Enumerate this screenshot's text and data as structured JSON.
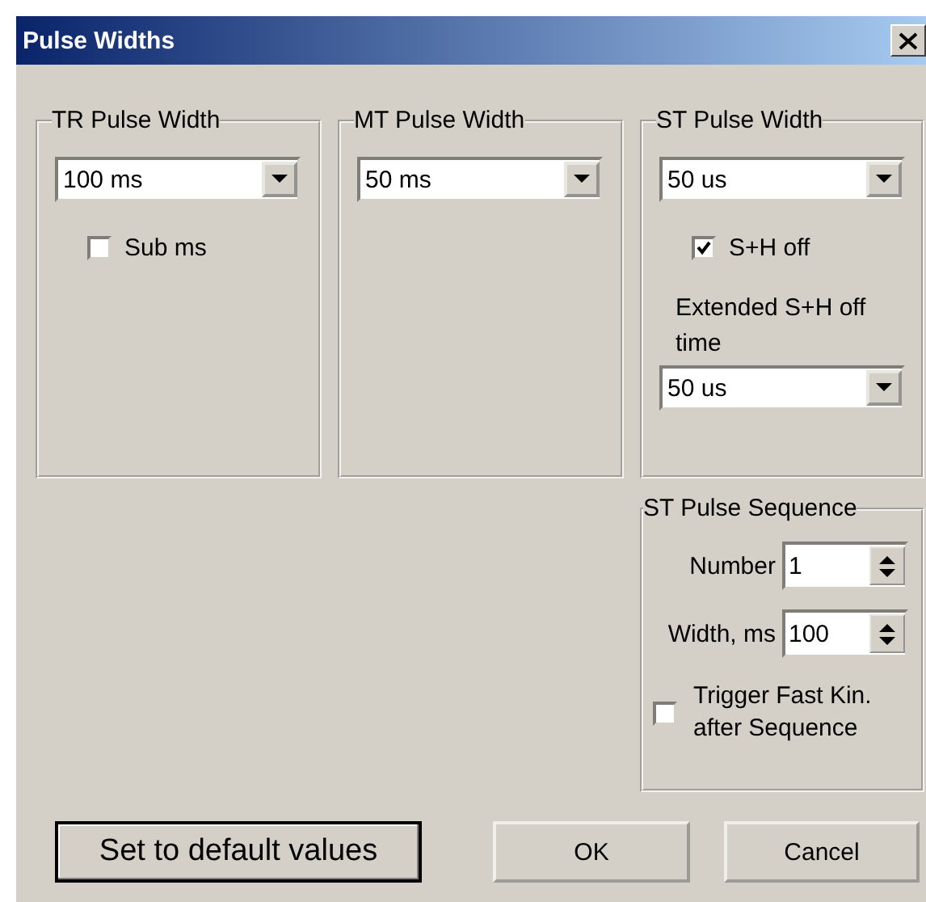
{
  "window": {
    "title": "Pulse Widths"
  },
  "tr_group": {
    "title": "TR Pulse Width",
    "dropdown": "100 ms",
    "checkbox": {
      "label": "Sub ms",
      "checked": false
    }
  },
  "mt_group": {
    "title": "MT Pulse Width",
    "dropdown": "50 ms"
  },
  "st_group": {
    "title": "ST Pulse Width",
    "dropdown": "50 us",
    "checkbox": {
      "label": "S+H off",
      "checked": true
    },
    "extended_label": "Extended S+H off time",
    "extended_dropdown": "50 us"
  },
  "sequence_group": {
    "title": "ST Pulse Sequence",
    "spinners": [
      {
        "label": "Number",
        "value": "1"
      },
      {
        "label": "Width, ms",
        "value": "100"
      }
    ],
    "checkbox": {
      "label": "Trigger Fast Kin. after Sequence",
      "checked": false
    }
  },
  "buttons": [
    {
      "label": "Set to default values",
      "default": true
    },
    {
      "label": "OK",
      "default": false
    },
    {
      "label": "Cancel",
      "default": false
    }
  ]
}
